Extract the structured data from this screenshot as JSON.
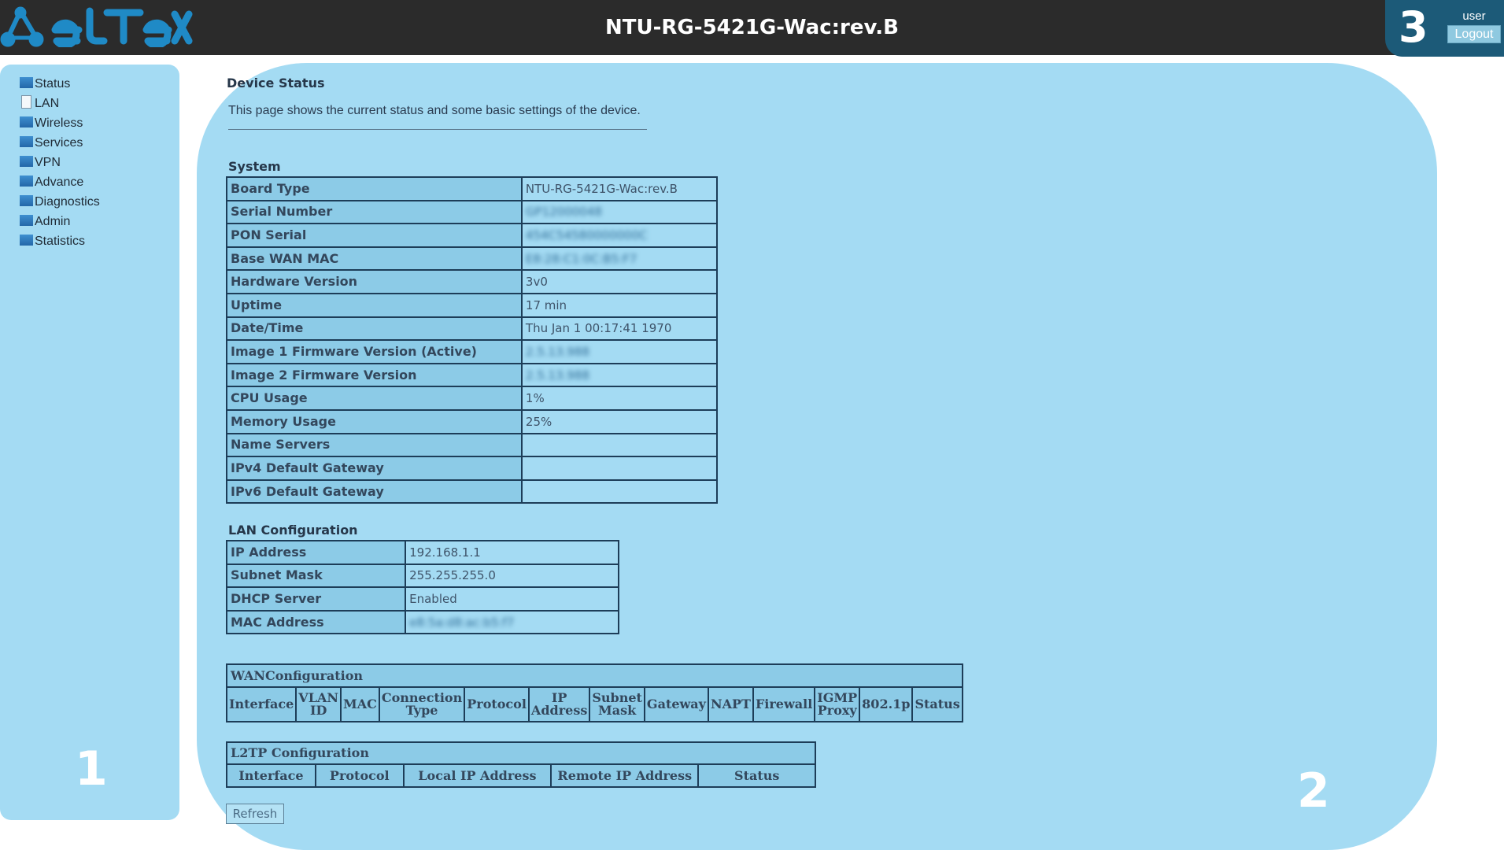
{
  "header": {
    "brand": "eltex",
    "device_title": "NTU-RG-5421G-Wac:rev.B",
    "user_marker": "3",
    "user_name": "user",
    "logout_label": "Logout"
  },
  "sidebar": {
    "items": [
      {
        "label": "Status",
        "icon": "folder-icon"
      },
      {
        "label": "LAN",
        "icon": "document-icon"
      },
      {
        "label": "Wireless",
        "icon": "folder-icon"
      },
      {
        "label": "Services",
        "icon": "folder-icon"
      },
      {
        "label": "VPN",
        "icon": "folder-icon"
      },
      {
        "label": "Advance",
        "icon": "folder-icon"
      },
      {
        "label": "Diagnostics",
        "icon": "folder-icon"
      },
      {
        "label": "Admin",
        "icon": "folder-icon"
      },
      {
        "label": "Statistics",
        "icon": "folder-icon"
      }
    ],
    "marker": "1"
  },
  "main": {
    "marker": "2",
    "title": "Device Status",
    "description": "This page shows the current status and some basic settings of the device.",
    "system": {
      "title": "System",
      "rows": [
        {
          "label": "Board Type",
          "value": "NTU-RG-5421G-Wac:rev.B"
        },
        {
          "label": "Serial Number",
          "value": "GP12000048"
        },
        {
          "label": "PON Serial",
          "value": "454C54580000000C"
        },
        {
          "label": "Base WAN MAC",
          "value": "E8:28:C1:0C:B5:F7"
        },
        {
          "label": "Hardware Version",
          "value": "3v0"
        },
        {
          "label": "Uptime",
          "value": "17 min"
        },
        {
          "label": "Date/Time",
          "value": "Thu Jan  1 00:17:41 1970"
        },
        {
          "label": "Image 1 Firmware Version (Active)",
          "value": "2.5.13.988"
        },
        {
          "label": "Image 2 Firmware Version",
          "value": "2.5.13.988"
        },
        {
          "label": "CPU Usage",
          "value": "1%"
        },
        {
          "label": "Memory Usage",
          "value": "25%"
        },
        {
          "label": "Name Servers",
          "value": ""
        },
        {
          "label": "IPv4 Default Gateway",
          "value": ""
        },
        {
          "label": "IPv6 Default Gateway",
          "value": ""
        }
      ]
    },
    "lan": {
      "title": "LAN Configuration",
      "rows": [
        {
          "label": "IP Address",
          "value": "192.168.1.1"
        },
        {
          "label": "Subnet Mask",
          "value": "255.255.255.0"
        },
        {
          "label": "DHCP Server",
          "value": "Enabled"
        },
        {
          "label": "MAC Address",
          "value": "e8:5a:d8:ac:b5:f7"
        }
      ]
    },
    "wan": {
      "title": "WANConfiguration",
      "columns": [
        "Interface",
        "VLAN ID",
        "MAC",
        "Connection Type",
        "Protocol",
        "IP Address",
        "Subnet Mask",
        "Gateway",
        "NAPT",
        "Firewall",
        "IGMP Proxy",
        "802.1p",
        "Status"
      ]
    },
    "l2tp": {
      "title": "L2TP Configuration",
      "columns": [
        "Interface",
        "Protocol",
        "Local IP Address",
        "Remote IP Address",
        "Status"
      ]
    },
    "refresh_label": "Refresh"
  },
  "colors": {
    "header_bg": "#2b2b2b",
    "brand_blue": "#1f8ac6",
    "panel_bg": "#a4dbf3",
    "label_cell_bg": "#8ccbe7",
    "user_box_bg": "#1c5a78"
  }
}
